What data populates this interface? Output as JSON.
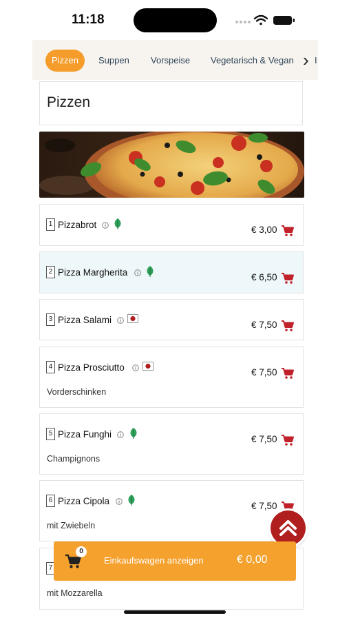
{
  "status_bar": {
    "time": "11:18"
  },
  "tabs": [
    {
      "label": "Pizzen",
      "active": true
    },
    {
      "label": "Suppen",
      "active": false
    },
    {
      "label": "Vorspeise",
      "active": false
    },
    {
      "label": "Vegetarisch & Vegan",
      "active": false
    }
  ],
  "tab_overflow_label": "I",
  "tab_next_icon": "chevron-right-icon",
  "category": {
    "title": "Pizzen"
  },
  "hero_image": "pizza-photo",
  "items": [
    {
      "num": "1",
      "name": "Pizzabrot",
      "badge": "leaf-icon",
      "desc": "",
      "price": "€ 3,00"
    },
    {
      "num": "2",
      "name": "Pizza Margherita",
      "badge": "leaf-icon",
      "desc": "",
      "price": "€ 6,50"
    },
    {
      "num": "3",
      "name": "Pizza Salami",
      "badge": "meat-icon",
      "desc": "",
      "price": "€ 7,50"
    },
    {
      "num": "4",
      "name": "Pizza Prosciutto",
      "badge": "meat-icon",
      "desc": "Vorderschinken",
      "price": "€ 7,50"
    },
    {
      "num": "5",
      "name": "Pizza Funghi",
      "badge": "leaf-icon",
      "desc": "Champignons",
      "price": "€ 7,50"
    },
    {
      "num": "6",
      "name": "Pizza Cipola",
      "badge": "leaf-icon",
      "desc": "mit Zwiebeln",
      "price": "€ 7,50"
    },
    {
      "num": "7",
      "name": "",
      "badge": "",
      "desc": "mit Mozzarella",
      "price": ""
    }
  ],
  "cart_bar": {
    "count": "0",
    "label": "Einkaufswagen anzeigen",
    "total": "€ 0,00"
  },
  "colors": {
    "accent": "#f59c2a",
    "cart_red": "#c0212a",
    "selected_row": "#eef7f9",
    "leaf_green": "#2fa15a",
    "meat_red": "#b01e1e"
  }
}
